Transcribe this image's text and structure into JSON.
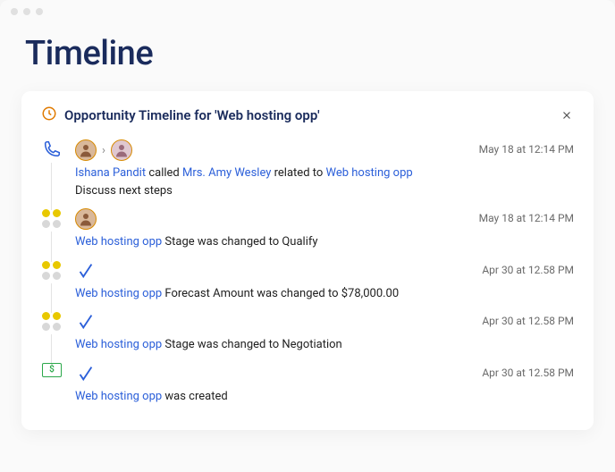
{
  "page": {
    "title": "Timeline"
  },
  "card": {
    "title": "Opportunity Timeline for 'Web hosting opp'",
    "entries": [
      {
        "icon": "phone",
        "ts": "May 18 at 12:14 PM",
        "avatars": [
          "Ishana Pandit",
          "Mrs. Amy Wesley"
        ],
        "line": {
          "a": "Ishana Pandit",
          "t1": " called ",
          "b": "Mrs. Amy Wesley",
          "t2": " related to ",
          "c": "Web hosting opp"
        },
        "line2": "Discuss next steps"
      },
      {
        "icon": "stage",
        "ts": "May 18 at 12:14 PM",
        "avatars": [
          "Ishana Pandit"
        ],
        "line": {
          "a": "Web hosting opp",
          "t1": " Stage was changed to Qualify"
        }
      },
      {
        "icon": "stage",
        "ts": "Apr 30 at 12.58 PM",
        "check": true,
        "line": {
          "a": "Web hosting opp",
          "t1": " Forecast Amount was changed to $78,000.00"
        }
      },
      {
        "icon": "stage",
        "ts": "Apr 30 at 12.58 PM",
        "check": true,
        "line": {
          "a": "Web hosting opp",
          "t1": " Stage was changed to Negotiation"
        }
      },
      {
        "icon": "money",
        "ts": "Apr 30 at 12.58 PM",
        "check": true,
        "line": {
          "a": "Web hosting opp",
          "t1": " was created"
        }
      }
    ]
  },
  "moneySymbol": "$"
}
